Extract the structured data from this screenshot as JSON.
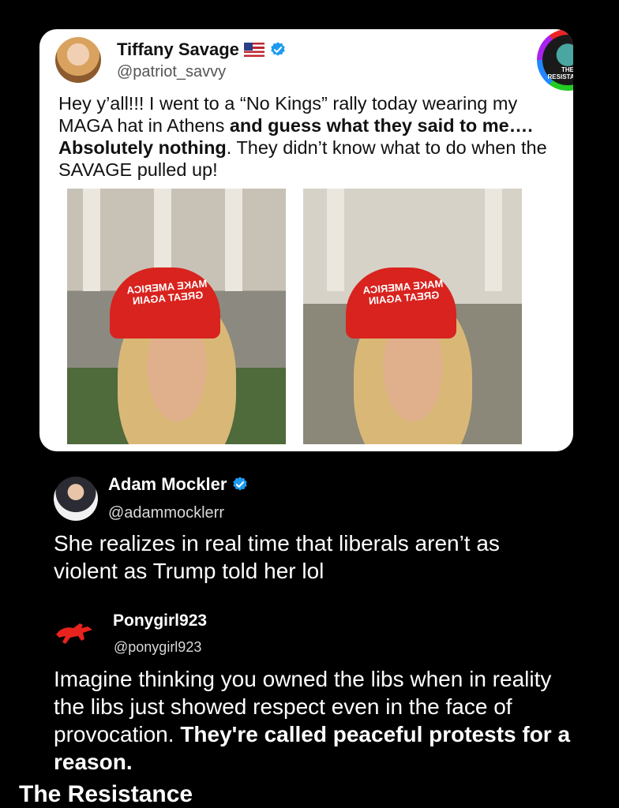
{
  "original_post": {
    "author_name": "Tiffany Savage",
    "author_flag": "us-flag-icon",
    "verified": "verified-badge-icon",
    "handle": "@patriot_savvy",
    "text_part1": "Hey y’all!!!  I went to a “No Kings” rally today wearing my MAGA hat in Athens ",
    "text_bold": "and guess what they said to me…. Absolutely nothing",
    "text_part2": ".  They didn’t  know what to do when the SAVAGE pulled up!",
    "photo_hat_text": "MAKE AMERICA GREAT AGAIN",
    "logo_text": "THE RESISTANCE"
  },
  "comment1": {
    "author_name": "Adam Mockler",
    "verified": "verified-badge-icon",
    "handle": "@adammocklerr",
    "text": "She realizes in real time that liberals aren’t as violent as Trump told her lol"
  },
  "comment2": {
    "author_name": "Ponygirl923",
    "handle": "@ponygirl923",
    "text_regular": "Imagine thinking you owned the libs when in reality the libs just showed respect even in the face of provocation. ",
    "text_bold": "They're called peaceful protests for a reason."
  },
  "footer": {
    "text": "The Resistance"
  },
  "colors": {
    "background": "#000000",
    "card": "#ffffff",
    "verified_blue": "#1d9bf0",
    "hat_red": "#d8231e"
  }
}
